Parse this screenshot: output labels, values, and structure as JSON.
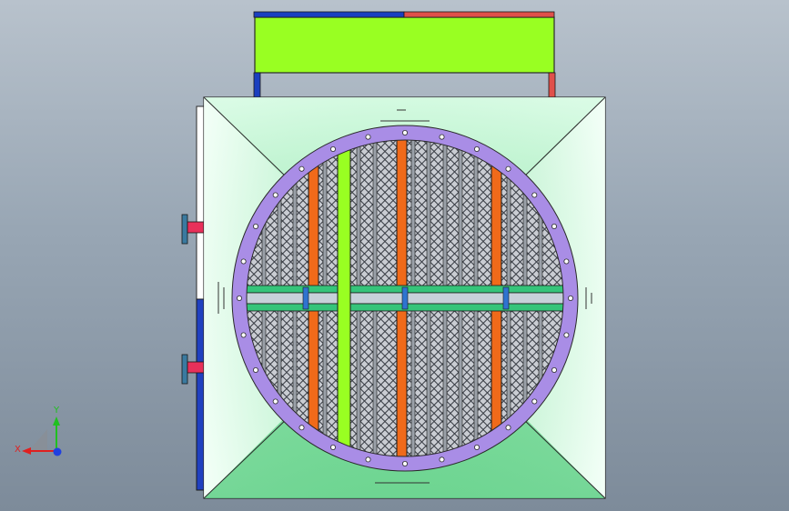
{
  "viewport": {
    "background_top": "#b8c2cc",
    "background_bottom": "#7d8b9a"
  },
  "model": {
    "colors": {
      "housing": "#b5f2c8",
      "header_box": "#99ff22",
      "flange_ring": "#a98de6",
      "tube_orange": "#f06a1a",
      "tube_lime": "#99ff22",
      "pipe_blue": "#1a3fbf",
      "pipe_red": "#e0504a",
      "side_strip_blue": "#2040c0",
      "divider_green": "#35c47a",
      "nozzle_pink": "#e8305a"
    },
    "side_nozzles": [
      "upper-side-nozzle",
      "lower-side-nozzle"
    ]
  },
  "triad": {
    "x_label": "X",
    "y_label": "Y",
    "colors": {
      "x": "#e02020",
      "y": "#20c020",
      "z": "#2040e0"
    }
  }
}
